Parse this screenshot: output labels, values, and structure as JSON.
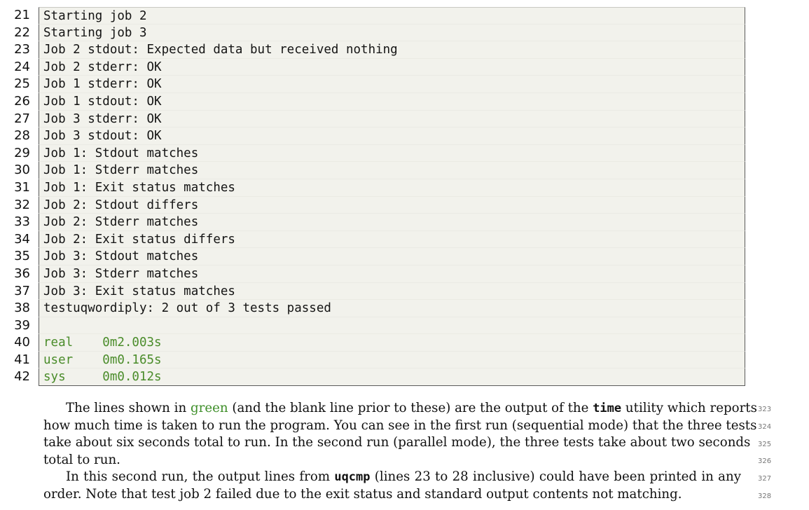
{
  "listing": {
    "lines": [
      {
        "num": "21",
        "text": "Starting job 2"
      },
      {
        "num": "22",
        "text": "Starting job 3"
      },
      {
        "num": "23",
        "text": "Job 2 stdout: Expected data but received nothing"
      },
      {
        "num": "24",
        "text": "Job 2 stderr: OK"
      },
      {
        "num": "25",
        "text": "Job 1 stderr: OK"
      },
      {
        "num": "26",
        "text": "Job 1 stdout: OK"
      },
      {
        "num": "27",
        "text": "Job 3 stderr: OK"
      },
      {
        "num": "28",
        "text": "Job 3 stdout: OK"
      },
      {
        "num": "29",
        "text": "Job 1: Stdout matches"
      },
      {
        "num": "30",
        "text": "Job 1: Stderr matches"
      },
      {
        "num": "31",
        "text": "Job 1: Exit status matches"
      },
      {
        "num": "32",
        "text": "Job 2: Stdout differs"
      },
      {
        "num": "33",
        "text": "Job 2: Stderr matches"
      },
      {
        "num": "34",
        "text": "Job 2: Exit status differs"
      },
      {
        "num": "35",
        "text": "Job 3: Stdout matches"
      },
      {
        "num": "36",
        "text": "Job 3: Stderr matches"
      },
      {
        "num": "37",
        "text": "Job 3: Exit status matches"
      },
      {
        "num": "38",
        "text": "testuqwordiply: 2 out of 3 tests passed"
      },
      {
        "num": "39",
        "text": ""
      },
      {
        "num": "40",
        "text": "real    0m2.003s",
        "highlight": true
      },
      {
        "num": "41",
        "text": "user    0m0.165s",
        "highlight": true
      },
      {
        "num": "42",
        "text": "sys     0m0.012s",
        "highlight": true
      }
    ],
    "highlight_color": "#4a8c2a"
  },
  "paragraph1": {
    "line1": {
      "part1": "The lines shown in ",
      "green": "green",
      "part2": " (and the blank line prior to these) are the output of the ",
      "code": "time",
      "part3": " utility which reports",
      "margin": "323"
    },
    "line2": {
      "text": "how much time is taken to run the program. You can see in the first run (sequential mode) that the three tests",
      "margin": "324"
    },
    "line3": {
      "text": "take about six seconds total to run. In the second run (parallel mode), the three tests take about two seconds",
      "margin": "325"
    },
    "line4": {
      "text": "total to run.",
      "margin": "326"
    }
  },
  "paragraph2": {
    "line1": {
      "part1": "In this second run, the output lines from ",
      "code": "uqcmp",
      "part2": " (lines 23 to 28 inclusive) could have been printed in any",
      "margin": "327"
    },
    "line2": {
      "text": "order. Note that test job 2 failed due to the exit status and standard output contents not matching.",
      "margin": "328"
    }
  }
}
